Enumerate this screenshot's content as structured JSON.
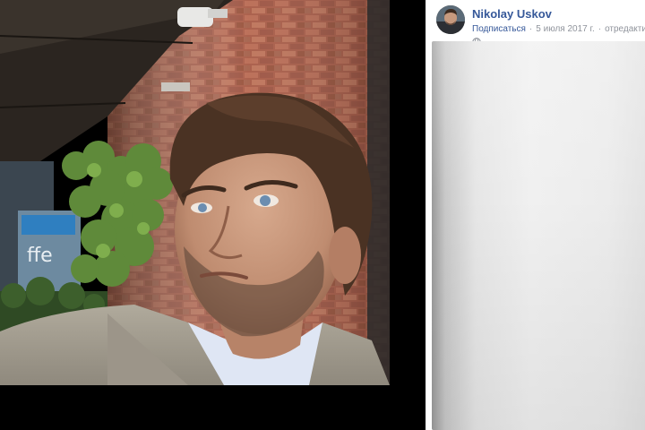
{
  "photo": {
    "alt_subject": "selfie-portrait",
    "cafe_sign_text": "ffe"
  },
  "post": {
    "author_name": "Nikolay Uskov",
    "subscribe_label": "Подписаться",
    "separator": "·",
    "date": "5 июля 2017 г.",
    "edited_label": "отредактиров",
    "privacy_icon": "globe-icon"
  },
  "colors": {
    "link_blue": "#365899",
    "meta_gray": "#90949c",
    "stage_bg": "#000000"
  }
}
